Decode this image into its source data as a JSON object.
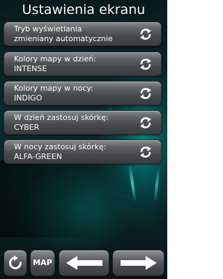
{
  "header": {
    "title": "Ustawienia ekranu"
  },
  "settings": [
    {
      "label": "Tryb wyświetlania\nzmieniany automatycznie",
      "value": ""
    },
    {
      "label": "Kolory mapy w dzień:",
      "value": "INTENSE"
    },
    {
      "label": "Kolory mapy w nocy:",
      "value": "INDIGO"
    },
    {
      "label": "W dzień zastosuj skórkę:",
      "value": "CYBER"
    },
    {
      "label": "W nocy zastosuj skórkę:",
      "value": "ALFA-GREEN"
    }
  ],
  "toolbar": {
    "map_label": "MAP"
  },
  "icons": {
    "item_action": "cycle-arrows-icon",
    "refresh": "refresh-icon",
    "back": "arrow-left-icon",
    "forward": "arrow-right-icon"
  },
  "colors": {
    "text": "#ffffff",
    "button": "#5e6264",
    "accent_glow": "#00d2c8"
  }
}
